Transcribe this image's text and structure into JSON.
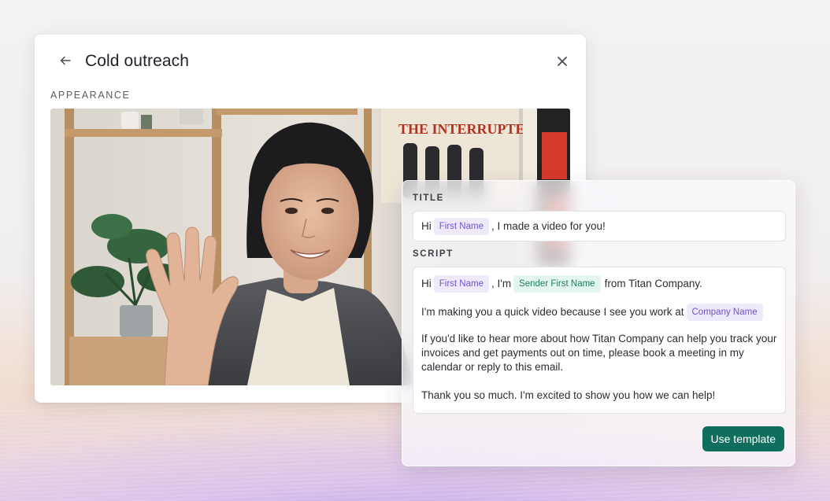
{
  "dialog": {
    "title": "Cold outreach",
    "appearance_label": "APPEARANCE"
  },
  "template": {
    "title_label": "TITLE",
    "title_parts": {
      "before": "Hi",
      "tag": "First Name",
      "after": ", I made a video for you!"
    },
    "script_label": "SCRIPT",
    "script": {
      "line1": {
        "hi": "Hi",
        "tag1": "First Name",
        "mid": ", I'm",
        "tag2": "Sender First Name",
        "end": "from Titan Company."
      },
      "line2": {
        "text": "I'm making you a quick video because I see you work at",
        "tag": "Company Name"
      },
      "para3": "If you'd like to hear more about how Titan Company can help you track your invoices and get payments out on time, please book a meeting in my calendar or reply to this email.",
      "para4": "Thank you so much. I'm excited to show you how we can help!"
    },
    "use_button": "Use template"
  },
  "colors": {
    "accent": "#0f6f5c",
    "tag_purple": "#6e55c9",
    "tag_green": "#1f7a60"
  },
  "icons": {
    "back": "arrow-left-icon",
    "close": "close-icon"
  },
  "poster": {
    "text": "THE INTERRUPTERS"
  }
}
